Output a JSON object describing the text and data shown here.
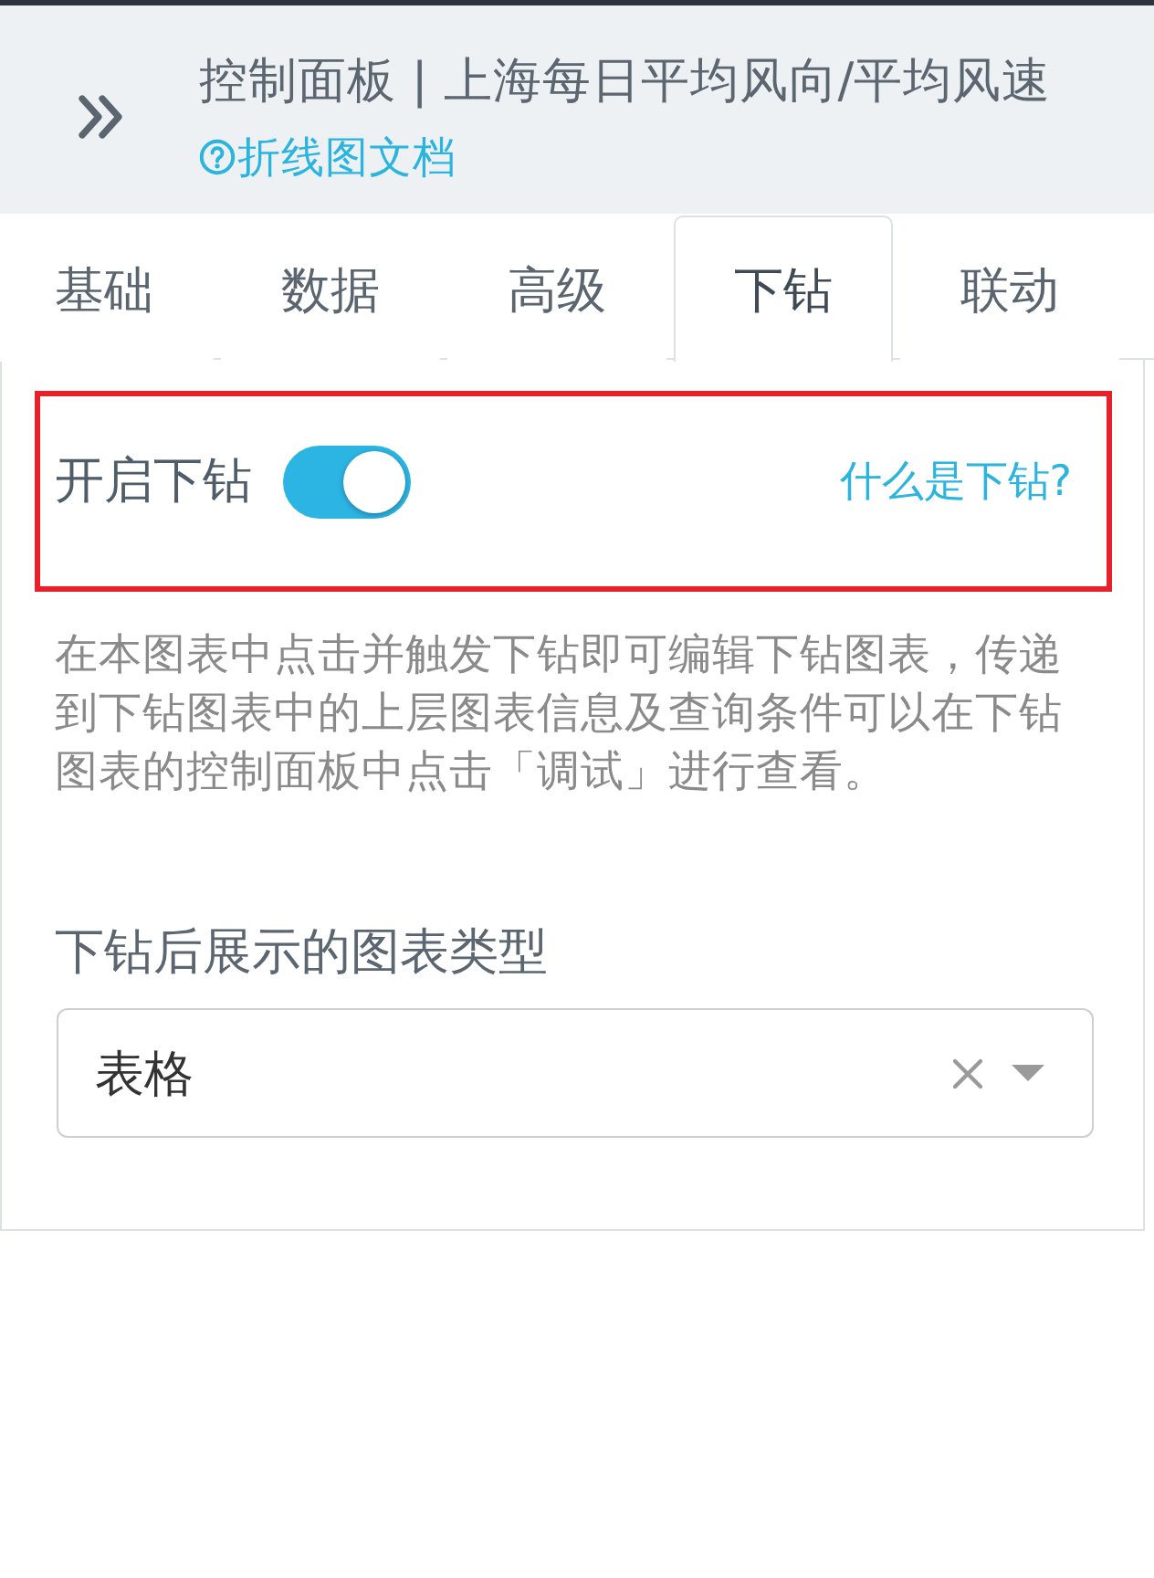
{
  "header": {
    "title": "控制面板 | 上海每日平均风向/平均风速",
    "doc_link": "折线图文档"
  },
  "tabs": [
    {
      "label": "基础",
      "selected": false
    },
    {
      "label": "数据",
      "selected": false
    },
    {
      "label": "高级",
      "selected": false
    },
    {
      "label": "下钻",
      "selected": true
    },
    {
      "label": "联动",
      "selected": false
    }
  ],
  "drilldown": {
    "highlighted": true,
    "label": "开启下钻",
    "on": true,
    "help_link": "什么是下钻?",
    "description": "在本图表中点击并触发下钻即可编辑下钻图表，传递到下钻图表中的上层图表信息及查询条件可以在下钻图表的控制面板中点击「调试」进行查看。",
    "chart_type": {
      "label": "下钻后展示的图表类型",
      "value": "表格"
    }
  }
}
